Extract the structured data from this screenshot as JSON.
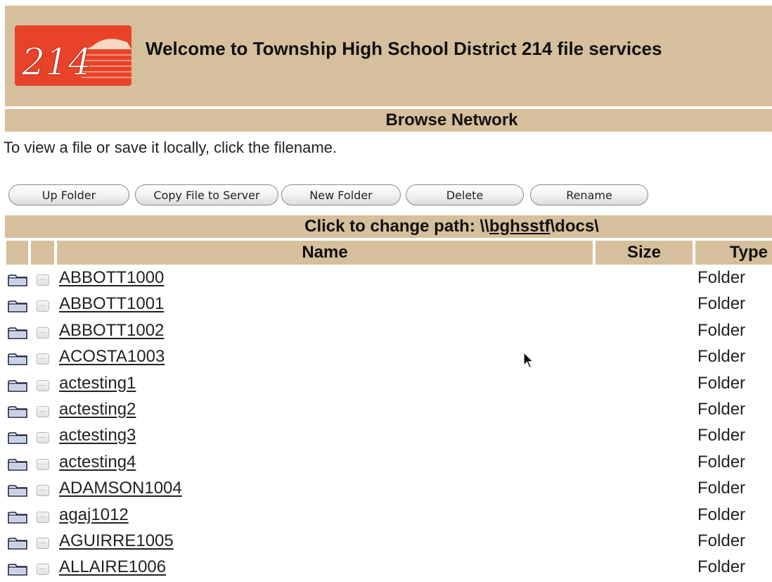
{
  "header": {
    "logo_text": "214",
    "welcome": "Welcome to Township High School District 214 file services"
  },
  "section_title": "Browse Network",
  "instructions": "To view a file or save it locally, click the filename.",
  "toolbar": {
    "up_folder": "Up Folder",
    "copy_file": "Copy File to Server",
    "new_folder": "New Folder",
    "delete": "Delete",
    "rename": "Rename"
  },
  "path": {
    "label": "Click to change path: \\\\",
    "host": "bghsstf",
    "rest": "\\docs\\"
  },
  "columns": {
    "name": "Name",
    "size": "Size",
    "type": "Type"
  },
  "rows": [
    {
      "name": "ABBOTT1000",
      "type": "Folder"
    },
    {
      "name": "ABBOTT1001",
      "type": "Folder"
    },
    {
      "name": "ABBOTT1002",
      "type": "Folder"
    },
    {
      "name": "ACOSTA1003",
      "type": "Folder"
    },
    {
      "name": "actesting1",
      "type": "Folder"
    },
    {
      "name": "actesting2",
      "type": "Folder"
    },
    {
      "name": "actesting3",
      "type": "Folder"
    },
    {
      "name": "actesting4",
      "type": "Folder"
    },
    {
      "name": "ADAMSON1004",
      "type": "Folder"
    },
    {
      "name": "agaj1012",
      "type": "Folder"
    },
    {
      "name": "AGUIRRE1005",
      "type": "Folder"
    },
    {
      "name": "ALLAIRE1006",
      "type": "Folder"
    }
  ],
  "colors": {
    "header_bg": "#d6bf9c",
    "logo_red": "#e8432a"
  },
  "icons": {
    "folder": "folder-icon",
    "checkbox": "checkbox-icon",
    "cursor": "mouse-pointer-icon"
  }
}
